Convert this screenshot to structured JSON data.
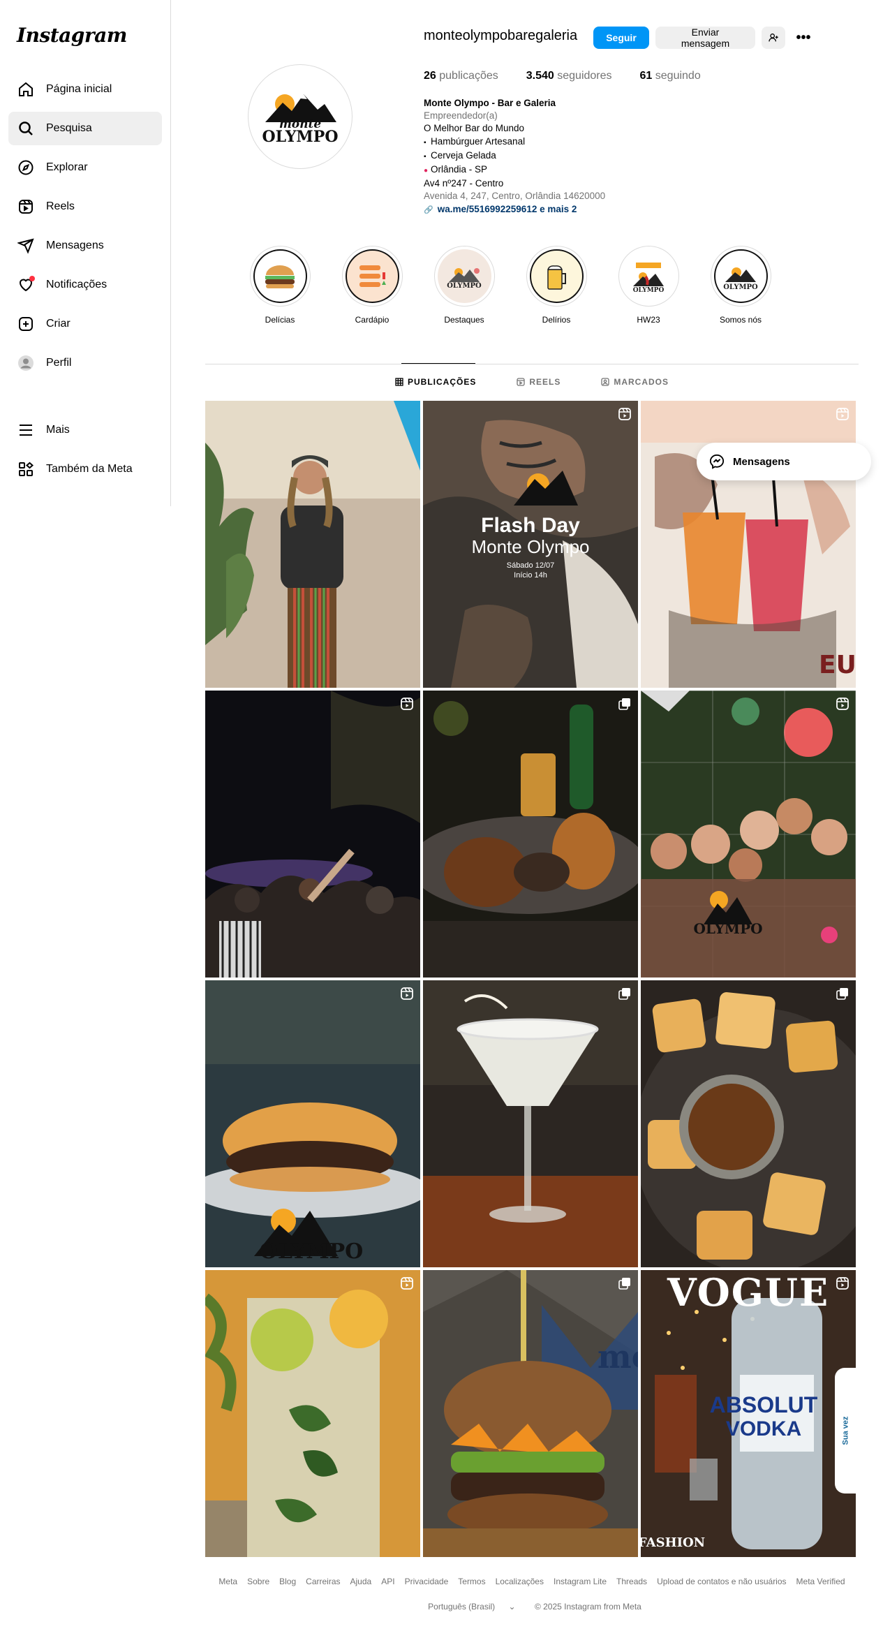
{
  "sidebar": {
    "logo": "Instagram",
    "items": [
      {
        "label": "Página inicial",
        "icon": "home-icon"
      },
      {
        "label": "Pesquisa",
        "icon": "search-icon"
      },
      {
        "label": "Explorar",
        "icon": "compass-icon"
      },
      {
        "label": "Reels",
        "icon": "reels-icon"
      },
      {
        "label": "Mensagens",
        "icon": "send-icon"
      },
      {
        "label": "Notificações",
        "icon": "heart-icon"
      },
      {
        "label": "Criar",
        "icon": "plus-square-icon"
      },
      {
        "label": "Perfil",
        "icon": "profile-icon"
      }
    ],
    "bottom": [
      {
        "label": "Mais",
        "icon": "menu-icon"
      },
      {
        "label": "Também da Meta",
        "icon": "meta-apps-icon"
      }
    ]
  },
  "profile": {
    "username": "monteolympobaregaleria",
    "follow_label": "Seguir",
    "message_label": "Enviar mensagem",
    "more_label": "•••",
    "stats": {
      "posts_value": "26",
      "posts_label": "publicações",
      "followers_value": "3.540",
      "followers_label": "seguidores",
      "following_value": "61",
      "following_label": "seguindo"
    },
    "logo_text_top": "monte",
    "logo_text_bottom": "OLYMPO",
    "bio": {
      "name": "Monte Olympo - Bar e Galeria",
      "category": "Empreendedor(a)",
      "line1": "O Melhor Bar do Mundo",
      "line2": "Hambúrguer Artesanal",
      "line3": "Cerveja Gelada",
      "line4": "Orlândia - SP",
      "line5": "Av4 nº247 - Centro",
      "address": "Avenida 4, 247, Centro, Orlândia 14620000",
      "link": "wa.me/5516992259612 e mais 2"
    }
  },
  "highlights": [
    {
      "label": "Delícias"
    },
    {
      "label": "Cardápio"
    },
    {
      "label": "Destaques"
    },
    {
      "label": "Delírios"
    },
    {
      "label": "HW23"
    },
    {
      "label": "Somos nós"
    }
  ],
  "tabs": [
    {
      "label": "PUBLICAÇÕES"
    },
    {
      "label": "REELS"
    },
    {
      "label": "MARCADOS"
    }
  ],
  "posts": {
    "flash_title": "Flash Day",
    "flash_sub": "Monte Olympo",
    "flash_date": "Sábado 12/07",
    "flash_time": "Início 14h",
    "vogue": "VOGUE",
    "absolut": "ABSOLUT",
    "vodka": "VODKA",
    "fashion": "FASHION",
    "side_tab": "Sua vez"
  },
  "floating": {
    "messages_label": "Mensagens"
  },
  "footer": {
    "links": [
      "Meta",
      "Sobre",
      "Blog",
      "Carreiras",
      "Ajuda",
      "API",
      "Privacidade",
      "Termos",
      "Localizações",
      "Instagram Lite",
      "Threads",
      "Upload de contatos e não usuários",
      "Meta Verified"
    ],
    "language": "Português (Brasil)",
    "copyright": "© 2025 Instagram from Meta"
  },
  "colors": {
    "accent": "#0095f6",
    "link": "#00376b",
    "notification": "#ff3040"
  }
}
